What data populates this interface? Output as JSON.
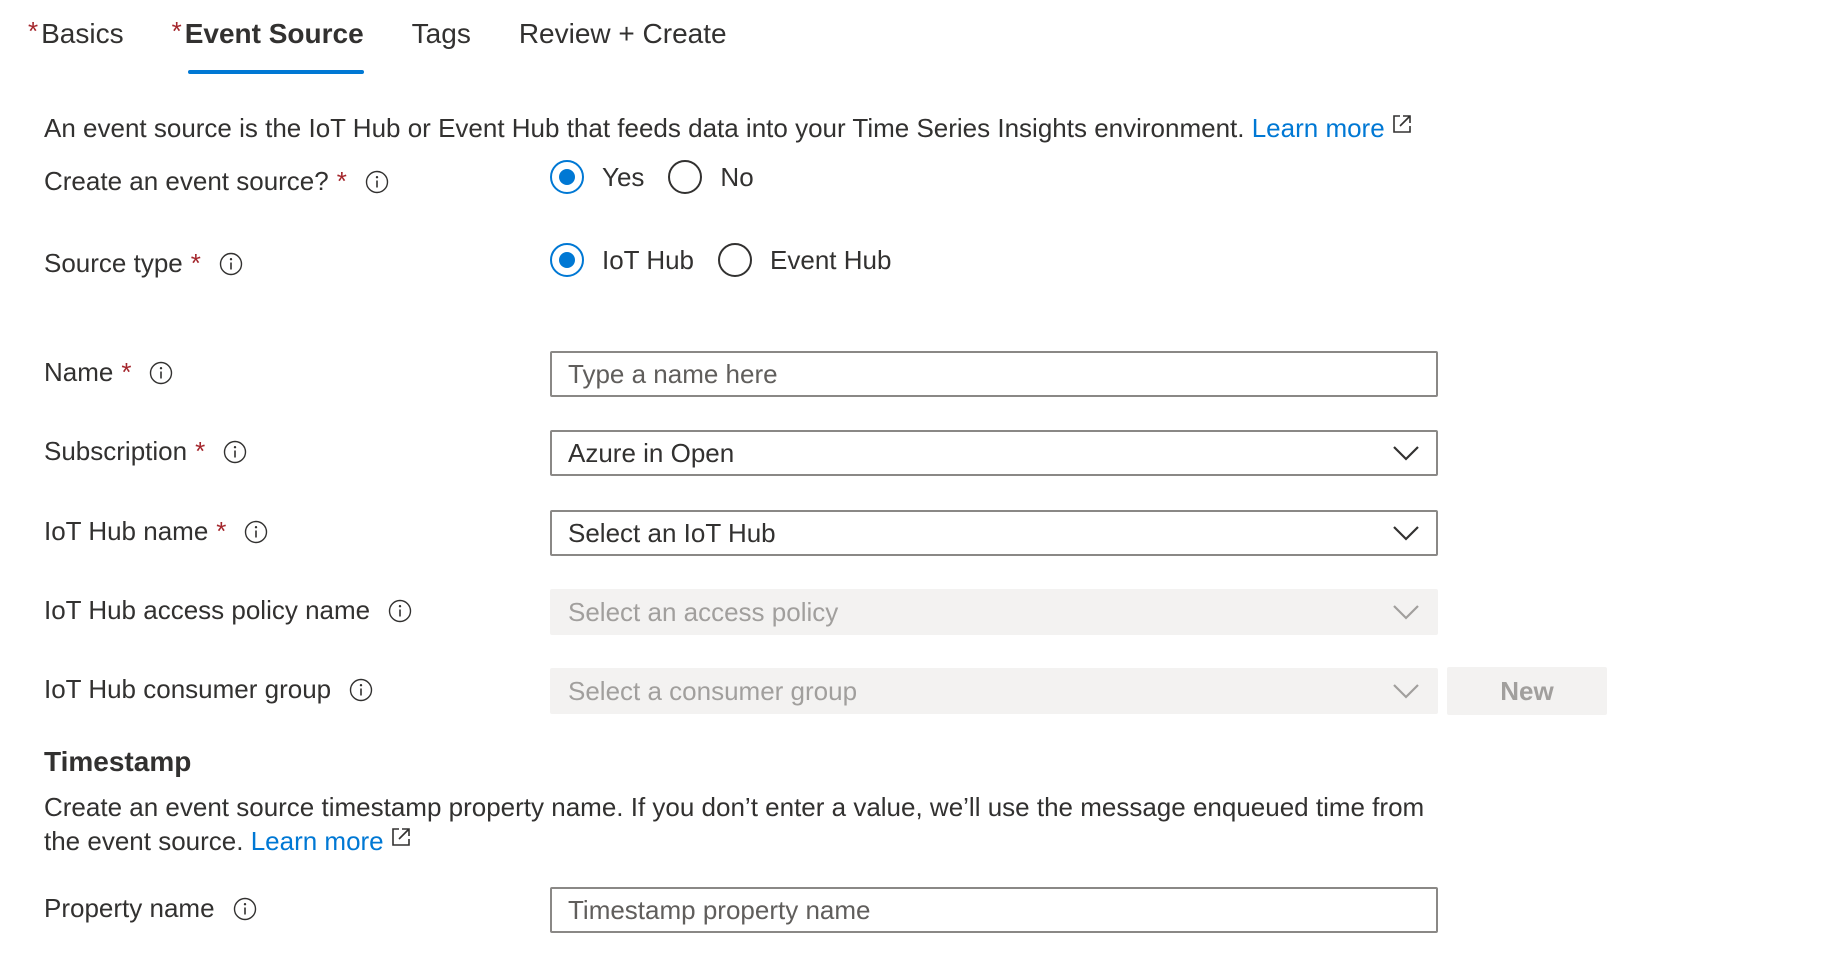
{
  "tabs": [
    {
      "label": "Basics",
      "required": true,
      "required_mark": "*",
      "active": false
    },
    {
      "label": "Event Source",
      "required": true,
      "required_mark": "*",
      "active": true
    },
    {
      "label": "Tags",
      "required": false,
      "required_mark": "",
      "active": false
    },
    {
      "label": "Review + Create",
      "required": false,
      "required_mark": "",
      "active": false
    }
  ],
  "intro": {
    "text": "An event source is the IoT Hub or Event Hub that feeds data into your Time Series Insights environment. ",
    "link": "Learn more"
  },
  "form": {
    "required_mark": "*",
    "create_event_source": {
      "label": "Create an event source?",
      "options": [
        "Yes",
        "No"
      ],
      "selected": "Yes"
    },
    "source_type": {
      "label": "Source type",
      "options": [
        "IoT Hub",
        "Event Hub"
      ],
      "selected": "IoT Hub"
    },
    "name": {
      "label": "Name",
      "placeholder": "Type a name here",
      "value": ""
    },
    "subscription": {
      "label": "Subscription",
      "value": "Azure in Open"
    },
    "iot_hub_name": {
      "label": "IoT Hub name",
      "value": "Select an IoT Hub"
    },
    "access_policy": {
      "label": "IoT Hub access policy name",
      "value": "Select an access policy"
    },
    "consumer_group": {
      "label": "IoT Hub consumer group",
      "value": "Select a consumer group",
      "new_button": "New"
    }
  },
  "timestamp": {
    "title": "Timestamp",
    "description": "Create an event source timestamp property name. If you don’t enter a value, we’ll use the message enqueued time from the event source. ",
    "link": "Learn more",
    "property_label": "Property name",
    "property_placeholder": "Timestamp property name"
  },
  "colors": {
    "accent": "#0078d4",
    "required": "#a4262c",
    "text": "#323130",
    "disabled_bg": "#f3f2f1",
    "disabled_text": "#a19f9d"
  }
}
